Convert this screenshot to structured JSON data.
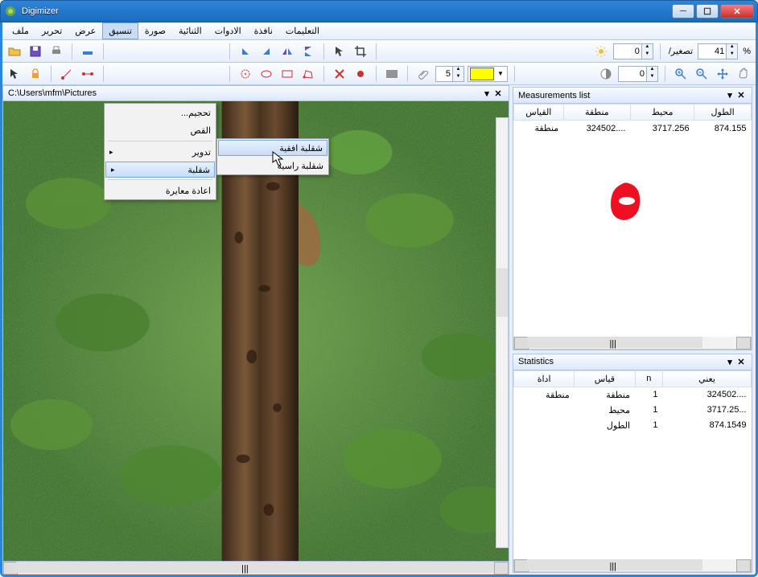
{
  "window": {
    "title": "Digimizer"
  },
  "menubar": {
    "items": [
      "ملف",
      "تحرير",
      "عرض",
      "تنسيق",
      "صورة",
      "الثنائية",
      "الادوات",
      "نافذة",
      "التعليمات"
    ],
    "active_index": 3
  },
  "toolbar": {
    "brightness_value": "0",
    "contrast_value": "0",
    "zoom_label": "/تصغير",
    "zoom_value": "41",
    "zoom_unit": "%",
    "stroke_value": "5"
  },
  "image_panel": {
    "path": "C:\\Users\\mfm\\Pictures"
  },
  "dropdown": {
    "items": [
      {
        "label": "تحجيم...",
        "has_arrow": false
      },
      {
        "label": "القص",
        "has_arrow": false
      },
      {
        "sep": true
      },
      {
        "label": "تدوير",
        "has_arrow": true
      },
      {
        "label": "شقلبة",
        "has_arrow": true,
        "hover": true
      },
      {
        "sep": true
      },
      {
        "label": "اعادة معايرة",
        "has_arrow": false
      }
    ],
    "submenu": [
      {
        "label": "شقلبة افقية",
        "hover": true
      },
      {
        "label": "شقلبة راسية",
        "hover": false
      }
    ]
  },
  "measurements": {
    "title": "Measurements list",
    "headers": [
      "القياس",
      "منطقة",
      "محيط",
      "الطول"
    ],
    "rows": [
      {
        "label": "منطقة",
        "area": "324502....",
        "perim": "3717.256",
        "len": "874.155"
      }
    ]
  },
  "statistics": {
    "title": "Statistics",
    "headers": [
      "اداة",
      "قياس",
      "n",
      "يعني"
    ],
    "rows": [
      {
        "tool": "منطقة",
        "meas": "منطقة",
        "n": "1",
        "mean": "324502...."
      },
      {
        "tool": "",
        "meas": "محيط",
        "n": "1",
        "mean": "3717.25..."
      },
      {
        "tool": "",
        "meas": "الطول",
        "n": "1",
        "mean": "874.1549"
      }
    ]
  }
}
